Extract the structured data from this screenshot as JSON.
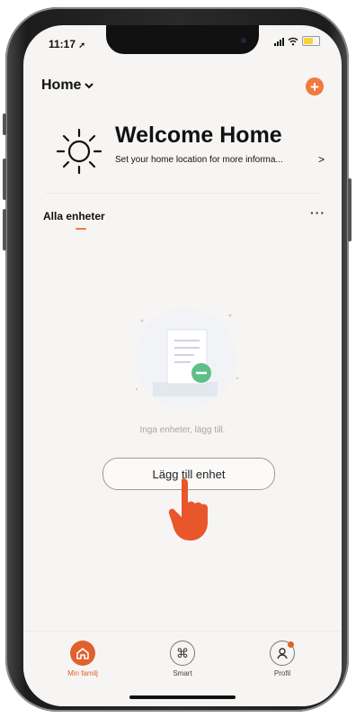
{
  "status": {
    "time": "11:17"
  },
  "header": {
    "home_label": "Home",
    "add_label": "+"
  },
  "welcome": {
    "title": "Welcome Home",
    "subtitle": "Set your home location for more informa...",
    "chevron": ">"
  },
  "tabs": {
    "all_devices": "Alla enheter",
    "more": "···"
  },
  "empty": {
    "message": "Inga enheter, lägg till.",
    "add_button": "Lägg till enhet"
  },
  "tabbar": {
    "items": [
      {
        "label": "Min familj",
        "icon": "home-icon",
        "active": true
      },
      {
        "label": "Smart",
        "icon": "command-icon",
        "active": false
      },
      {
        "label": "Profil",
        "icon": "profile-icon",
        "active": false
      }
    ]
  },
  "colors": {
    "accent": "#f07b3f",
    "background": "#f7f5f3",
    "muted_text": "#a7a7a7"
  }
}
